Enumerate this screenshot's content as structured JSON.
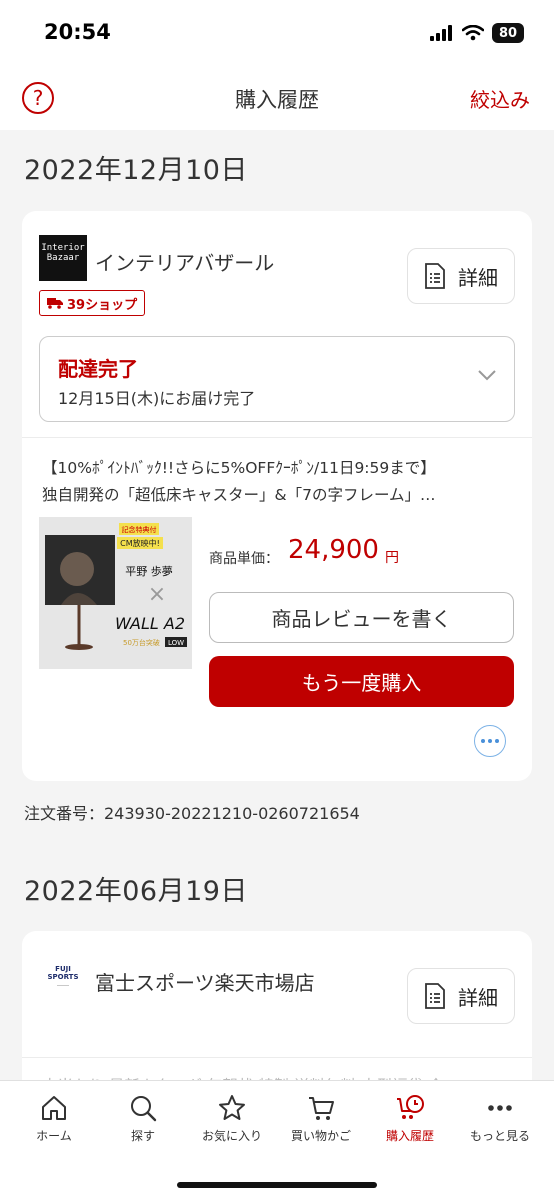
{
  "status_bar": {
    "time": "20:54",
    "battery": "80"
  },
  "header": {
    "help_icon": "question-circle-icon",
    "title": "購入履歴",
    "filter_label": "絞込み"
  },
  "orders": [
    {
      "date": "2022年12月10日",
      "shop": {
        "name": "インテリアバザール",
        "logo_text": "Interior Bazaar",
        "badge": "39ショップ"
      },
      "detail_label": "詳細",
      "delivery": {
        "status": "配達完了",
        "detail": "12月15日(木)にお届け完了"
      },
      "item": {
        "title_line1": "【10%ﾎﾟｲﾝﾄﾊﾞｯｸ!!さらに5%OFFｸｰﾎﾟﾝ/11日9:59まで】",
        "title_line2": "独自開発の「超低床キャスター」&「7の字フレーム」…",
        "image_texts": {
          "promo": "記念特典付",
          "cm": "CM放映中!",
          "person": "平野 歩夢",
          "product": "WALL A2",
          "low": "LOW",
          "sold": "50万台突破"
        },
        "price_label": "商品単価：",
        "price": "24,900",
        "price_unit": "円",
        "review_button": "商品レビューを書く",
        "rebuy_button": "もう一度購入"
      },
      "order_number": "注文番号：243930-20221210-0260721654"
    },
    {
      "date": "2022年06月19日",
      "shop": {
        "name": "富士スポーツ楽天市場店",
        "logo_text": "FUJI SPORTS",
        "logo_sub": "Rakuten Ichiba"
      },
      "detail_label": "詳細",
      "item": {
        "title_partial": "大当たり 最新カタログ 年賀状 特製 送料無料 大型福袋 全"
      }
    }
  ],
  "tab_bar": [
    {
      "label": "ホーム",
      "icon": "home-icon"
    },
    {
      "label": "探す",
      "icon": "search-icon"
    },
    {
      "label": "お気に入り",
      "icon": "star-icon"
    },
    {
      "label": "買い物かご",
      "icon": "cart-icon"
    },
    {
      "label": "購入履歴",
      "icon": "purchase-history-icon",
      "active": true
    },
    {
      "label": "もっと見る",
      "icon": "more-icon"
    }
  ],
  "colors": {
    "accent": "#bf0000",
    "background": "#f4f4f4",
    "link_blue": "#4a90d9"
  }
}
